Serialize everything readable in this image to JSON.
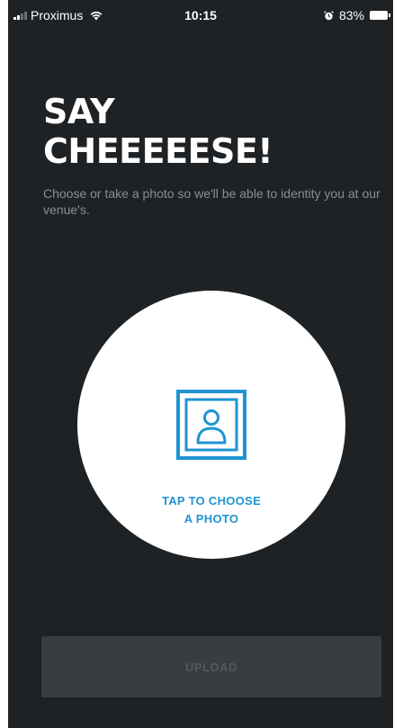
{
  "status_bar": {
    "carrier": "Proximus",
    "time": "10:15",
    "battery_percent": "83%",
    "icons": [
      "signal-icon",
      "wifi-icon",
      "alarm-icon",
      "battery-icon"
    ]
  },
  "header": {
    "title_line1": "SAY",
    "title_line2": "CHEEEEESE!",
    "subtitle": "Choose or take a photo so we'll be able to identity you at our venue's."
  },
  "photo_picker": {
    "icon": "portrait-photo-icon",
    "label_line1": "TAP TO CHOOSE",
    "label_line2": "A PHOTO"
  },
  "upload_button": {
    "label": "UPLOAD",
    "enabled": false
  },
  "colors": {
    "background": "#1f2224",
    "accent": "#1f94d2",
    "title": "#ffffff",
    "subtitle": "#8a8e91",
    "button_disabled_bg": "#3a3d40",
    "button_disabled_text": "#55595c"
  }
}
